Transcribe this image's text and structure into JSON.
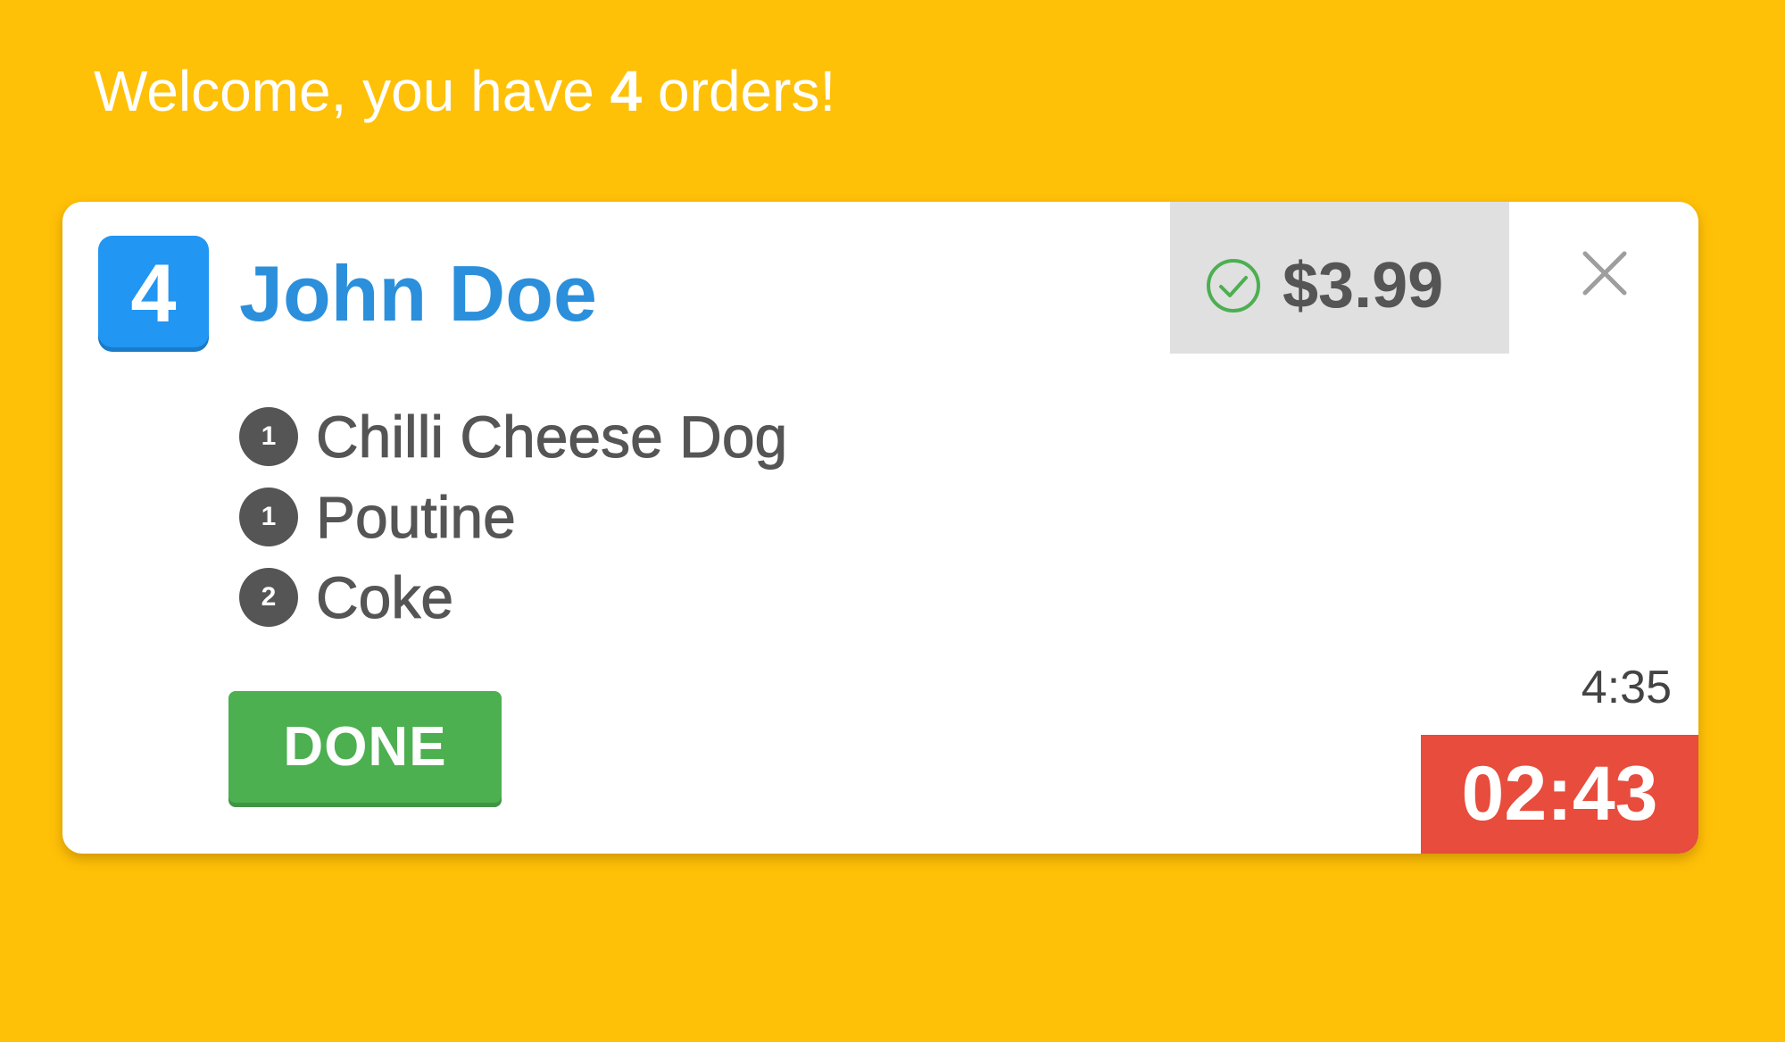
{
  "header": {
    "welcome_prefix": "Welcome, you have ",
    "order_count": "4",
    "welcome_suffix": " orders!"
  },
  "order": {
    "number": "4",
    "customer_name": "John Doe",
    "payment": {
      "status_icon": "check-circle-icon",
      "price": "$3.99"
    },
    "close_icon": "close-icon",
    "items": [
      {
        "qty": "1",
        "name": "Chilli Cheese Dog"
      },
      {
        "qty": "1",
        "name": "Poutine"
      },
      {
        "qty": "2",
        "name": "Coke"
      }
    ],
    "done_label": "DONE",
    "order_time": "4:35",
    "elapsed": "02:43"
  },
  "colors": {
    "background": "#FFC107",
    "badge": "#2196F3",
    "name": "#2B8FDB",
    "done": "#4CAF50",
    "timer": "#E74C3C",
    "check": "#4CAF50"
  }
}
